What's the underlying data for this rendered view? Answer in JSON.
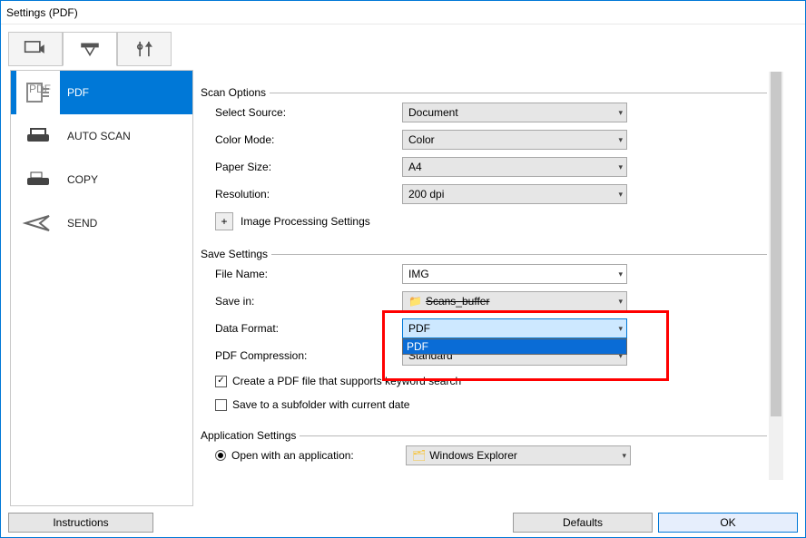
{
  "window": {
    "title": "Settings (PDF)"
  },
  "sidebar": {
    "items": [
      {
        "label": "PDF"
      },
      {
        "label": "AUTO SCAN"
      },
      {
        "label": "COPY"
      },
      {
        "label": "SEND"
      }
    ]
  },
  "scan_options": {
    "legend": "Scan Options",
    "select_source_label": "Select Source:",
    "select_source_value": "Document",
    "color_mode_label": "Color Mode:",
    "color_mode_value": "Color",
    "paper_size_label": "Paper Size:",
    "paper_size_value": "A4",
    "resolution_label": "Resolution:",
    "resolution_value": "200 dpi",
    "image_proc_label": "Image Processing Settings"
  },
  "save_settings": {
    "legend": "Save Settings",
    "file_name_label": "File Name:",
    "file_name_value": "IMG",
    "save_in_label": "Save in:",
    "save_in_value": "Scans_buffer",
    "data_format_label": "Data Format:",
    "data_format_value": "PDF",
    "data_format_option": "PDF",
    "pdf_compression_label": "PDF Compression:",
    "pdf_compression_value": "Standard",
    "chk_keyword": "Create a PDF file that supports keyword search",
    "chk_subfolder": "Save to a subfolder with current date"
  },
  "app_settings": {
    "legend": "Application Settings",
    "open_with_label": "Open with an application:",
    "open_with_value": "Windows Explorer"
  },
  "footer": {
    "instructions": "Instructions",
    "defaults": "Defaults",
    "ok": "OK"
  }
}
